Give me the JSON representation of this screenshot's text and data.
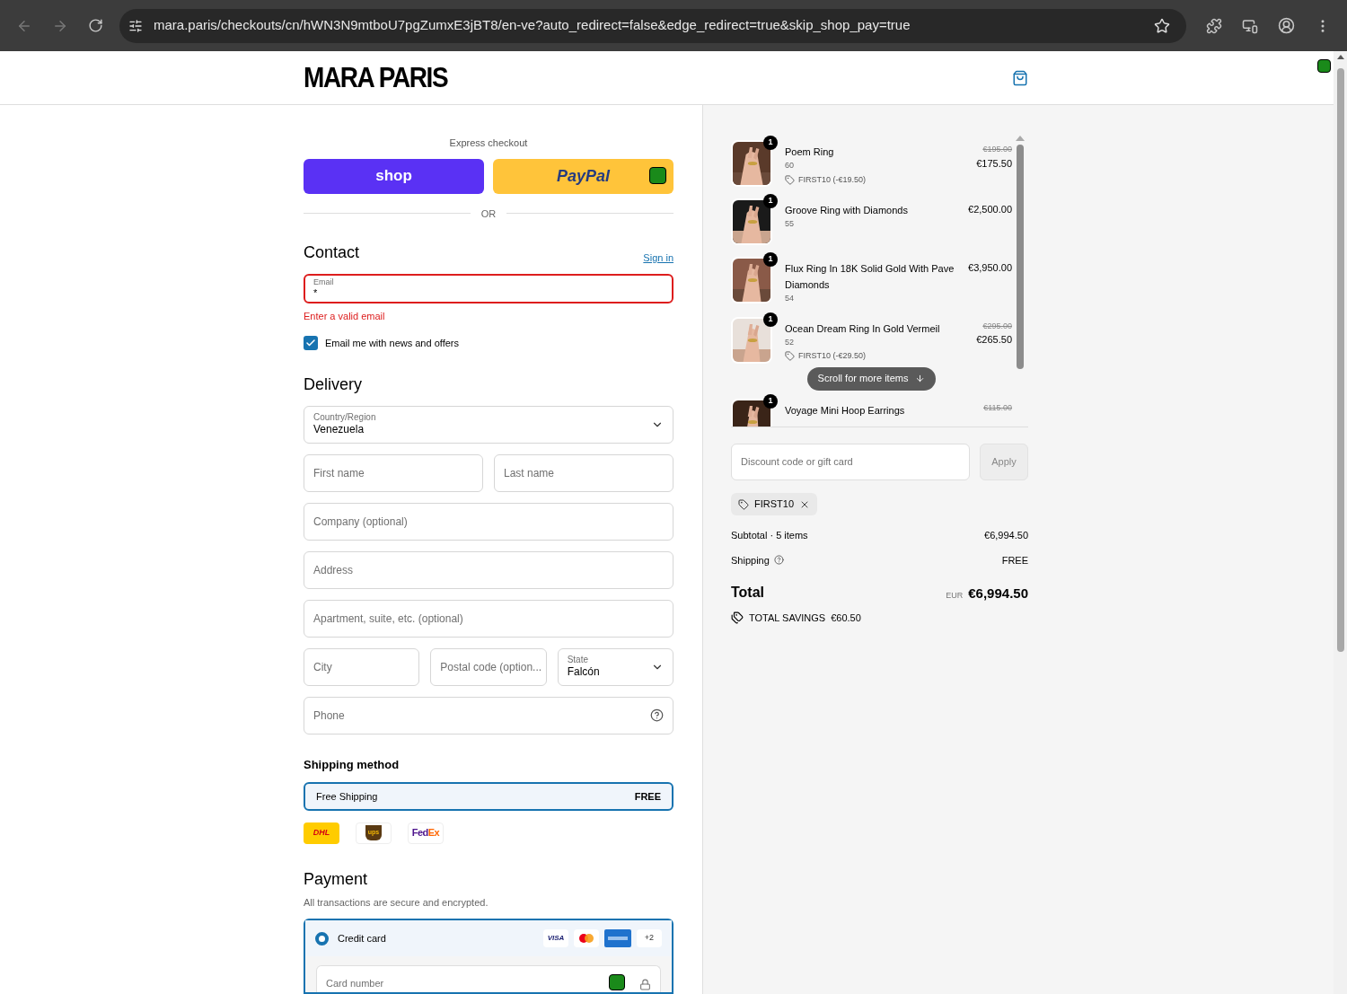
{
  "browser": {
    "url": "mara.paris/checkouts/cn/hWN3N9mtboU7pgZumxE3jBT8/en-ve?auto_redirect=false&edge_redirect=true&skip_shop_pay=true"
  },
  "header": {
    "logo": "MARA PARIS"
  },
  "express": {
    "title": "Express checkout",
    "buttons": [
      {
        "kind": "shop",
        "label": "shop"
      },
      {
        "kind": "paypal",
        "label": "PayPal"
      }
    ],
    "divider": "OR"
  },
  "contact": {
    "title": "Contact",
    "sign_in": "Sign in",
    "email": {
      "label": "Email",
      "value": "*",
      "invalid": true
    },
    "error": "Enter a valid email",
    "newsletter": {
      "label": "Email me with news and offers",
      "checked": true
    }
  },
  "delivery": {
    "title": "Delivery",
    "rows": [
      [
        {
          "kind": "select",
          "label": "Country/Region",
          "value": "Venezuela"
        }
      ],
      [
        {
          "kind": "input",
          "placeholder": "First name"
        },
        {
          "kind": "input",
          "placeholder": "Last name"
        }
      ],
      [
        {
          "kind": "input",
          "placeholder": "Company (optional)"
        }
      ],
      [
        {
          "kind": "input",
          "placeholder": "Address"
        }
      ],
      [
        {
          "kind": "input",
          "placeholder": "Apartment, suite, etc. (optional)"
        }
      ],
      [
        {
          "kind": "input",
          "placeholder": "City"
        },
        {
          "kind": "input",
          "placeholder": "Postal code (option..."
        },
        {
          "kind": "select",
          "label": "State",
          "value": "Falcón"
        }
      ],
      [
        {
          "kind": "help",
          "placeholder": "Phone"
        }
      ]
    ]
  },
  "shipping": {
    "title": "Shipping method",
    "options": [
      {
        "label": "Free Shipping",
        "price": "FREE",
        "selected": true
      }
    ],
    "carriers": [
      {
        "kind": "dhl",
        "parts": [
          "DHL"
        ]
      },
      {
        "kind": "ups",
        "parts": [
          "ups"
        ]
      },
      {
        "kind": "fedex",
        "parts": [
          "Fed",
          "Ex"
        ]
      }
    ]
  },
  "payment": {
    "title": "Payment",
    "note": "All transactions are secure and encrypted.",
    "methods": [
      {
        "label": "Credit card",
        "selected": true,
        "cards": [
          {
            "kind": "visa",
            "text": "VISA"
          },
          {
            "kind": "mastercard"
          },
          {
            "kind": "amex"
          },
          {
            "kind": "more",
            "text": "+2"
          }
        ]
      }
    ],
    "card_number": {
      "placeholder": "Card number"
    }
  },
  "summary": {
    "items": [
      {
        "name": "Poem Ring",
        "variant": "60",
        "quantity": "1",
        "discount": "FIRST10 (-€19.50)",
        "old_price": "€195.00",
        "price": "€175.50"
      },
      {
        "name": "Groove Ring with Diamonds",
        "variant": "55",
        "quantity": "1",
        "price": "€2,500.00"
      },
      {
        "name": "Flux Ring In 18K Solid Gold With Pave Diamonds",
        "variant": "54",
        "quantity": "1",
        "price": "€3,950.00"
      },
      {
        "name": "Ocean Dream Ring In Gold Vermeil",
        "variant": "52",
        "quantity": "1",
        "discount": "FIRST10 (-€29.50)",
        "old_price": "€295.00",
        "price": "€265.50"
      },
      {
        "name": "Voyage Mini Hoop Earrings",
        "quantity": "1",
        "old_price": "€115.00"
      }
    ],
    "scroll_hint": "Scroll for more items",
    "discount": {
      "placeholder": "Discount code or gift card",
      "apply": "Apply",
      "disabled": true
    },
    "codes": [
      "FIRST10"
    ],
    "subtotal": {
      "label": "Subtotal · 5 items",
      "value": "€6,994.50"
    },
    "shipping": {
      "label": "Shipping",
      "value": "FREE"
    },
    "total": {
      "label": "Total",
      "currency": "EUR",
      "value": "€6,994.50"
    },
    "savings": {
      "label": "TOTAL SAVINGS",
      "value": "€60.50"
    }
  }
}
